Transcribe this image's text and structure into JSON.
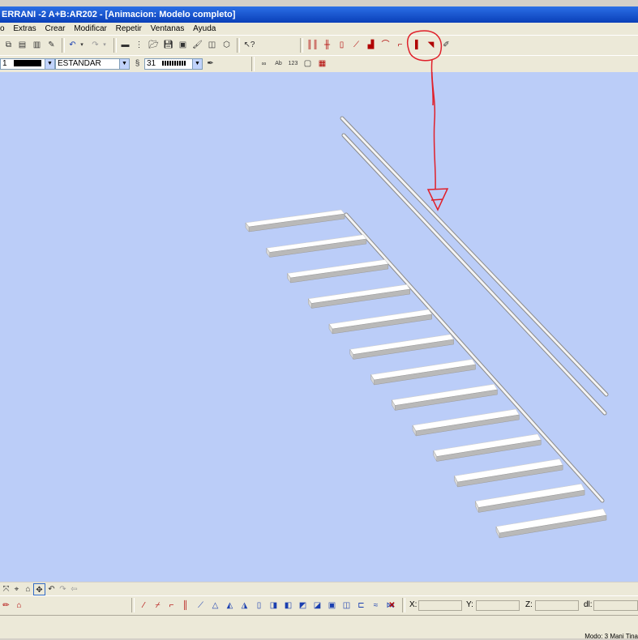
{
  "window": {
    "title": "ERRANI -2   A+B:AR202 - [Animacion: Modelo completo]"
  },
  "menu": {
    "items": [
      "o",
      "Extras",
      "Crear",
      "Modificar",
      "Repetir",
      "Ventanas",
      "Ayuda"
    ]
  },
  "toolbar2": {
    "pen_number": "1",
    "line_type": "ESTANDAR",
    "layer_number": "31"
  },
  "coords": {
    "x_label": "X:",
    "y_label": "Y:",
    "z_label": "Z:",
    "dl_label": "dl:"
  },
  "status": {
    "text": "Modo:  3 Mani  Tina"
  },
  "colors": {
    "viewport_bg": "#bbcdf8",
    "annotation": "#e0202a"
  }
}
